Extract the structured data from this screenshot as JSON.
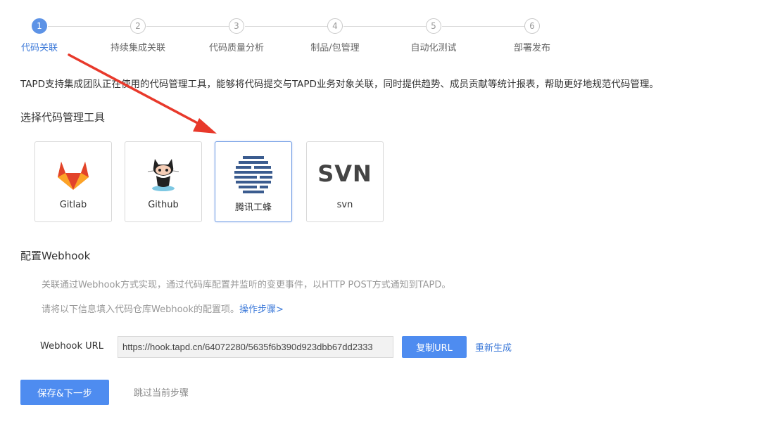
{
  "stepper": {
    "steps": [
      {
        "num": "1",
        "label": "代码关联"
      },
      {
        "num": "2",
        "label": "持续集成关联"
      },
      {
        "num": "3",
        "label": "代码质量分析"
      },
      {
        "num": "4",
        "label": "制品/包管理"
      },
      {
        "num": "5",
        "label": "自动化测试"
      },
      {
        "num": "6",
        "label": "部署发布"
      }
    ],
    "active_step": 1
  },
  "intro": "TAPD支持集成团队正在使用的代码管理工具，能够将代码提交与TAPD业务对象关联，同时提供趋势、成员贡献等统计报表，帮助更好地规范代码管理。",
  "tools": {
    "title": "选择代码管理工具",
    "items": [
      {
        "label": "Gitlab",
        "icon": "gitlab-icon"
      },
      {
        "label": "Github",
        "icon": "github-octocat-icon"
      },
      {
        "label": "腾讯工蜂",
        "icon": "tencent-gongfeng-icon"
      },
      {
        "label": "svn",
        "icon": "svn-icon",
        "logo_text": "SVN"
      }
    ],
    "selected": "腾讯工蜂"
  },
  "webhook": {
    "title": "配置Webhook",
    "hint1": "关联通过Webhook方式实现，通过代码库配置并监听的变更事件，以HTTP POST方式通知到TAPD。",
    "hint2": "请将以下信息填入代码仓库Webhook的配置项。",
    "steps_link": "操作步骤>",
    "url_label": "Webhook URL",
    "url_value": "https://hook.tapd.cn/64072280/5635f6b390d923dbb67dd2333",
    "copy_label": "复制URL",
    "regen_label": "重新生成"
  },
  "footer": {
    "save_label": "保存&下一步",
    "skip_label": "跳过当前步骤"
  },
  "colors": {
    "accent": "#4e8cf0",
    "active_step": "#5d93e6",
    "annotation_arrow": "#e8392b"
  }
}
